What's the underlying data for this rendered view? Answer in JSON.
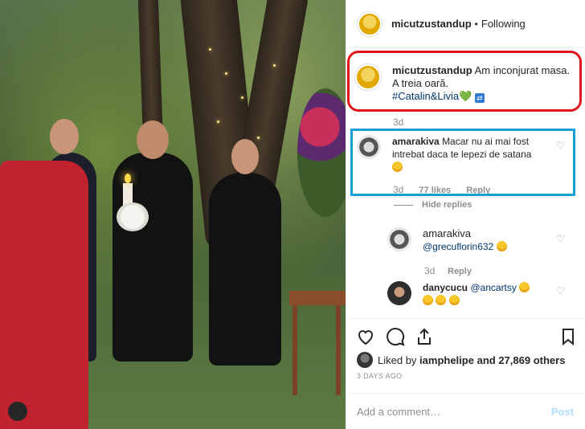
{
  "header": {
    "username": "micutzustandup",
    "dot": "•",
    "follow_label": "Following"
  },
  "caption": {
    "username": "micutzustandup",
    "text_line1": "Am inconjurat masa.",
    "text_line2": "A treia oară.",
    "hashtag": "#Catalin&Livia",
    "heart": "💚",
    "badge": "⇄",
    "time": "3d"
  },
  "comments": [
    {
      "username": "amarakiva",
      "text": "Macar nu ai mai fost intrebat daca te lepezi de satana",
      "time": "3d",
      "likes": "77 likes",
      "reply": "Reply"
    }
  ],
  "hide_replies": "Hide replies",
  "replies": [
    {
      "username": "amarakiva",
      "mention": "@grecuflorin632",
      "time": "3d",
      "reply": "Reply"
    },
    {
      "username": "danycucu",
      "mention": "@ancartsy"
    }
  ],
  "likes": {
    "prefix": "Liked by",
    "user": "iamphelipe",
    "rest": "and 27,869 others"
  },
  "date": "3 DAYS AGO",
  "comment_input": {
    "placeholder": "Add a comment…"
  },
  "post_label": "Post",
  "colors": {
    "highlight_red": "#e0141b",
    "highlight_blue": "#1aa0d9",
    "link": "#00376b",
    "muted": "#8e8e8e"
  },
  "icons": [
    "heart-icon",
    "comment-icon",
    "share-icon",
    "bookmark-icon",
    "like-heart-icon"
  ]
}
